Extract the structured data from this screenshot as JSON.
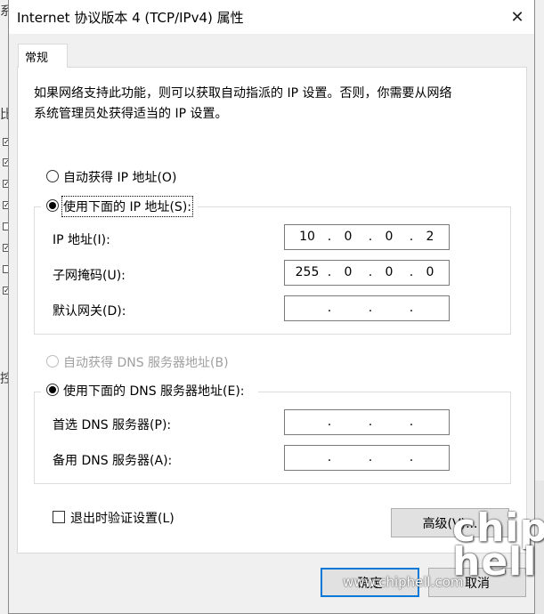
{
  "dialog": {
    "title": "Internet 协议版本 4 (TCP/IPv4) 属性",
    "close_glyph": "✕"
  },
  "tabs": [
    {
      "label": "常规",
      "selected": true
    }
  ],
  "description_line1": "如果网络支持此功能，则可以获取自动指派的 IP 设置。否则，你需要从网络",
  "description_line2": "系统管理员处获得适当的 IP 设置。",
  "ip_mode": {
    "auto_label": "自动获得 IP 地址(O)",
    "manual_label": "使用下面的 IP 地址(S):",
    "selected": "manual"
  },
  "ip_fields": {
    "ip_label": "IP 地址(I):",
    "ip_octets": [
      "10",
      "0",
      "0",
      "2"
    ],
    "mask_label": "子网掩码(U):",
    "mask_octets": [
      "255",
      "0",
      "0",
      "0"
    ],
    "gateway_label": "默认网关(D):",
    "gateway_octets": [
      "",
      "",
      "",
      ""
    ]
  },
  "dns_mode": {
    "auto_label": "自动获得 DNS 服务器地址(B)",
    "auto_enabled": false,
    "manual_label": "使用下面的 DNS 服务器地址(E):",
    "selected": "manual"
  },
  "dns_fields": {
    "preferred_label": "首选 DNS 服务器(P):",
    "preferred_octets": [
      "",
      "",
      "",
      ""
    ],
    "alternate_label": "备用 DNS 服务器(A):",
    "alternate_octets": [
      "",
      "",
      "",
      ""
    ]
  },
  "validate_on_exit": {
    "label": "退出时验证设置(L)",
    "checked": false
  },
  "buttons": {
    "advanced": "高级(V)...",
    "ok": "确定",
    "cancel": "取消"
  },
  "watermark": {
    "text": "www.chiphell.com",
    "logo": "chip hell"
  },
  "background_window": {
    "fragments": [
      "系",
      "比",
      "控"
    ]
  },
  "colors": {
    "focus_border": "#0078d7",
    "disabled_text": "#a0a0a0"
  }
}
